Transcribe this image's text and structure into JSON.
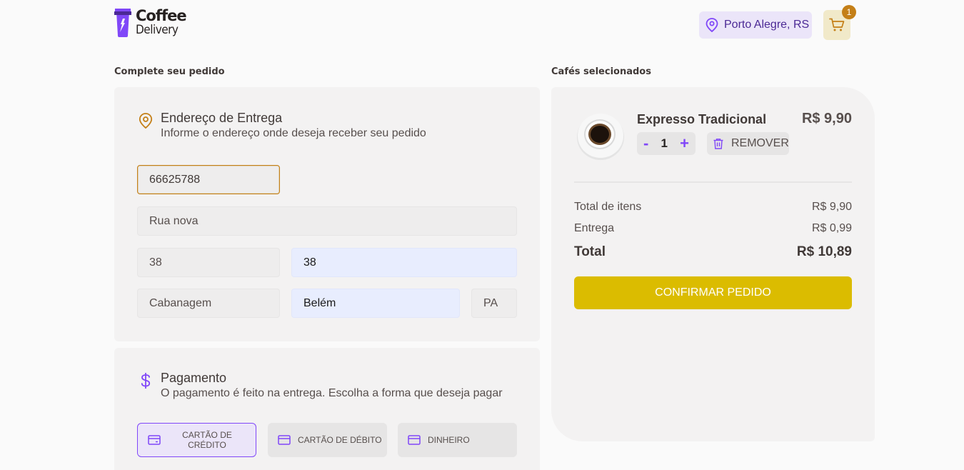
{
  "header": {
    "logo": {
      "line1": "Coffee",
      "line2": "Delivery"
    },
    "location": "Porto Alegre, RS",
    "cart_count": "1"
  },
  "colors": {
    "accent_purple": "#8047f8",
    "accent_yellow": "#dbbc00",
    "dark_yellow": "#c47f17"
  },
  "order": {
    "title": "Complete seu pedido",
    "address": {
      "title": "Endereço de Entrega",
      "subtitle": "Informe o endereço onde deseja receber seu pedido",
      "fields": {
        "cep": "66625788",
        "street": "Rua nova",
        "number": "38",
        "complement": "38",
        "neighborhood": "Cabanagem",
        "city": "Belém",
        "uf": "PA"
      }
    },
    "payment": {
      "title": "Pagamento",
      "subtitle": "O pagamento é feito na entrega. Escolha a forma que deseja pagar",
      "options": [
        {
          "label": "Cartão de crédito",
          "icon": "credit-card-icon",
          "selected": true
        },
        {
          "label": "Cartão de débito",
          "icon": "bank-icon",
          "selected": false
        },
        {
          "label": "Dinheiro",
          "icon": "money-icon",
          "selected": false
        }
      ]
    }
  },
  "cart": {
    "title": "Cafés selecionados",
    "items": [
      {
        "name": "Expresso Tradicional",
        "price": "R$ 9,90",
        "quantity": "1",
        "minus": "-",
        "plus": "+",
        "remove_label": "REMOVER"
      }
    ],
    "summary": {
      "items_label": "Total de itens",
      "items_value": "R$ 9,90",
      "delivery_label": "Entrega",
      "delivery_value": "R$ 0,99",
      "total_label": "Total",
      "total_value": "R$ 10,89"
    },
    "confirm_label": "Confirmar pedido"
  }
}
